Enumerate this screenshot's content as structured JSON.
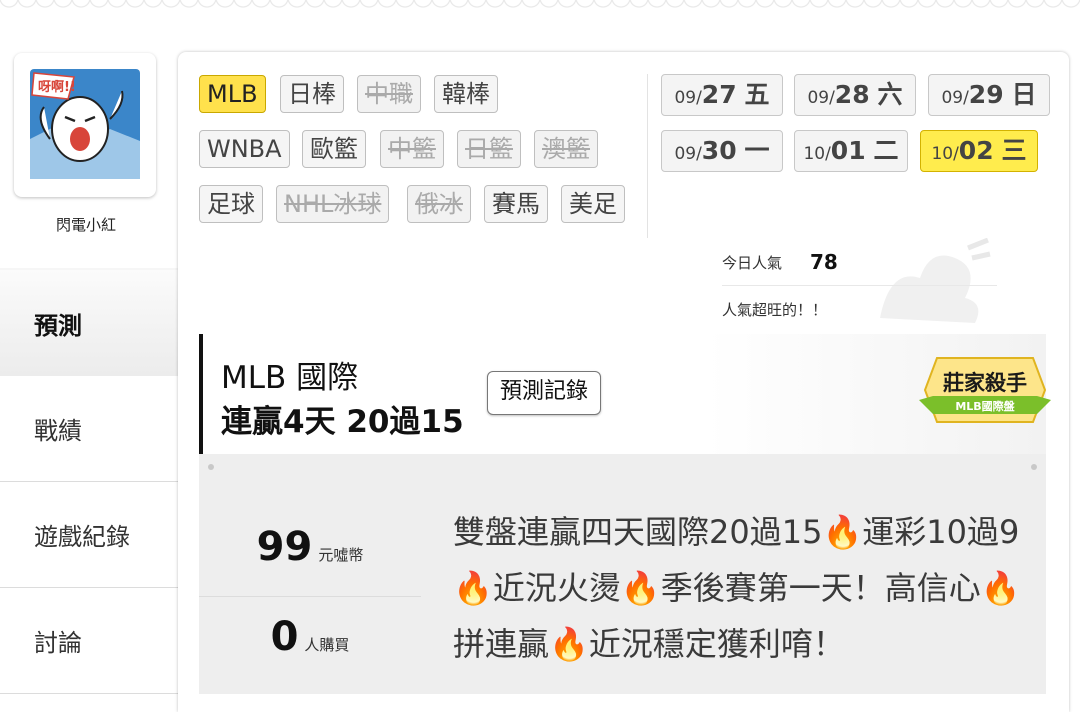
{
  "user": {
    "name": "閃電小紅",
    "avatar_caption": "呀啊!!"
  },
  "sidebar": {
    "items": [
      {
        "label": "預測",
        "active": true
      },
      {
        "label": "戰績",
        "active": false
      },
      {
        "label": "遊戲紀錄",
        "active": false
      },
      {
        "label": "討論",
        "active": false
      }
    ]
  },
  "sports": [
    {
      "label": "MLB",
      "state": "selected"
    },
    {
      "label": "日棒",
      "state": "normal"
    },
    {
      "label": "中職",
      "state": "disabled"
    },
    {
      "label": "韓棒",
      "state": "normal"
    },
    {
      "label": "WNBA",
      "state": "normal"
    },
    {
      "label": "歐籃",
      "state": "normal"
    },
    {
      "label": "中籃",
      "state": "disabled"
    },
    {
      "label": "日籃",
      "state": "disabled"
    },
    {
      "label": "澳籃",
      "state": "disabled"
    },
    {
      "label": "足球",
      "state": "normal"
    },
    {
      "label": "NHL冰球",
      "state": "disabled"
    },
    {
      "label": "俄冰",
      "state": "disabled"
    },
    {
      "label": "賽馬",
      "state": "normal"
    },
    {
      "label": "美足",
      "state": "normal"
    }
  ],
  "dates": [
    {
      "prefix": "09/",
      "day": "27",
      "weekday": "五",
      "selected": false
    },
    {
      "prefix": "09/",
      "day": "28",
      "weekday": "六",
      "selected": false
    },
    {
      "prefix": "09/",
      "day": "29",
      "weekday": "日",
      "selected": false
    },
    {
      "prefix": "09/",
      "day": "30",
      "weekday": "一",
      "selected": false
    },
    {
      "prefix": "10/",
      "day": "01",
      "weekday": "二",
      "selected": false
    },
    {
      "prefix": "10/",
      "day": "02",
      "weekday": "三",
      "selected": true
    }
  ],
  "popularity": {
    "label": "今日人氣",
    "value": "78",
    "note": "人氣超旺的！！"
  },
  "card": {
    "league": "MLB 國際",
    "streak": "連贏4天 20過15",
    "record_button": "預測記錄",
    "badge": {
      "title": "莊家殺手",
      "subtitle": "MLB國際盤"
    },
    "price": {
      "value": "99",
      "unit": "元噓幣"
    },
    "buyers": {
      "value": "0",
      "unit": "人購買"
    },
    "description": "雙盤連贏四天國際20過15🔥運彩10過9🔥近況火燙🔥季後賽第一天！高信心🔥拼連贏🔥近況穩定獲利唷！"
  },
  "colors": {
    "selected_sport": "#ffe14c",
    "selected_date": "#ffec4d",
    "badge_green": "#7bbf2a",
    "badge_gold": "#f2c62e"
  }
}
